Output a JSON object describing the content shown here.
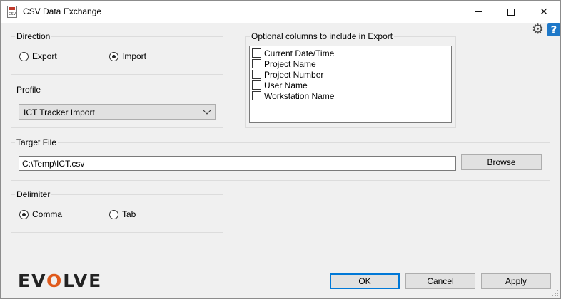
{
  "window": {
    "title": "CSV Data Exchange",
    "icon_text": "CSV",
    "minimize_icon": "minimize-icon",
    "maximize_icon": "maximize-icon",
    "close_glyph": "✕"
  },
  "toolbar": {
    "settings_glyph": "⚙",
    "help_glyph": "?"
  },
  "direction": {
    "title": "Direction",
    "options": [
      {
        "label": "Export",
        "selected": false
      },
      {
        "label": "Import",
        "selected": true
      }
    ]
  },
  "profile": {
    "title": "Profile",
    "selected": "ICT Tracker Import"
  },
  "optional_columns": {
    "title": "Optional columns to include in Export",
    "items": [
      {
        "label": "Current Date/Time",
        "checked": false
      },
      {
        "label": "Project Name",
        "checked": false
      },
      {
        "label": "Project Number",
        "checked": false
      },
      {
        "label": "User Name",
        "checked": false
      },
      {
        "label": "Workstation Name",
        "checked": false
      }
    ]
  },
  "target_file": {
    "title": "Target File",
    "value": "C:\\Temp\\ICT.csv",
    "browse_label": "Browse"
  },
  "delimiter": {
    "title": "Delimiter",
    "options": [
      {
        "label": "Comma",
        "selected": true
      },
      {
        "label": "Tab",
        "selected": false
      }
    ]
  },
  "footer": {
    "logo": {
      "pre": "EV",
      "o": "O",
      "post": "LVE"
    },
    "ok_label": "OK",
    "cancel_label": "Cancel",
    "apply_label": "Apply"
  },
  "colors": {
    "accent": "#0078d7",
    "logo_accent": "#e05a1c",
    "help_blue": "#1e78c8"
  }
}
